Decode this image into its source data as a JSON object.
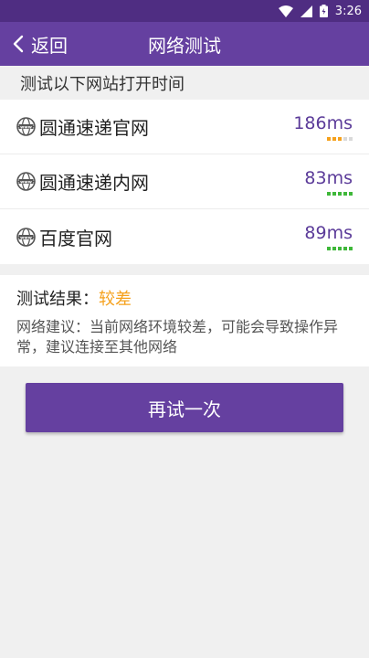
{
  "status_bar": {
    "time": "3:26",
    "icons": [
      "wifi-icon",
      "signal-icon",
      "battery-icon"
    ]
  },
  "app_bar": {
    "back_label": "返回",
    "title": "网络测试"
  },
  "section": {
    "header": "测试以下网站打开时间"
  },
  "sites": [
    {
      "name": "圆通速递官网",
      "latency": "186ms",
      "signal_level": 3,
      "signal_color": "#f5a11c",
      "icon": "globe-icon"
    },
    {
      "name": "圆通速递内网",
      "latency": "83ms",
      "signal_level": 5,
      "signal_color": "#3fb83a",
      "icon": "globe-icon"
    },
    {
      "name": "百度官网",
      "latency": "89ms",
      "signal_level": 5,
      "signal_color": "#3fb83a",
      "icon": "globe-icon"
    }
  ],
  "result": {
    "label": "测试结果：",
    "value": "较差",
    "advice": "网络建议：当前网络环境较差，可能会导致操作异常，建议连接至其他网络"
  },
  "retry_button": {
    "label": "再试一次"
  },
  "colors": {
    "app_bar": "#6540a0",
    "status_bar": "#4f2d82",
    "latency_text": "#5b3b99",
    "warning": "#f5a11c",
    "good": "#3fb83a",
    "signal_empty": "#d9d9d9"
  }
}
